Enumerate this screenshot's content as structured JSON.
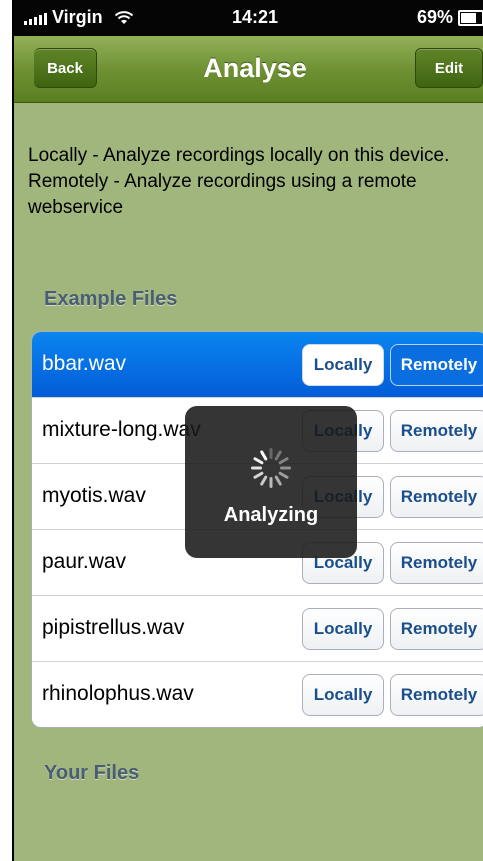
{
  "status_bar": {
    "carrier": "Virgin",
    "time": "14:21",
    "battery": "69%"
  },
  "nav": {
    "back_label": "Back",
    "title": "Analyse",
    "edit_label": "Edit"
  },
  "description": {
    "line1": "Locally - Analyze recordings locally on this device.",
    "line2": "Remotely - Analyze recordings using a remote webservice"
  },
  "sections": {
    "example_files": "Example Files",
    "your_files": "Your Files"
  },
  "files": [
    {
      "name": "bbar.wav",
      "local_label": "Locally",
      "remote_label": "Remotely",
      "selected": true
    },
    {
      "name": "mixture-long.wav",
      "local_label": "Locally",
      "remote_label": "Remotely",
      "selected": false
    },
    {
      "name": "myotis.wav",
      "local_label": "Locally",
      "remote_label": "Remotely",
      "selected": false
    },
    {
      "name": "paur.wav",
      "local_label": "Locally",
      "remote_label": "Remotely",
      "selected": false
    },
    {
      "name": "pipistrellus.wav",
      "local_label": "Locally",
      "remote_label": "Remotely",
      "selected": false
    },
    {
      "name": "rhinolophus.wav",
      "local_label": "Locally",
      "remote_label": "Remotely",
      "selected": false
    }
  ],
  "hud": {
    "label": "Analyzing"
  },
  "colors": {
    "background": "#a0b67c",
    "nav_bar": "#6c8f31",
    "selected_row": "#0a85ef",
    "section_header": "#4a5d74"
  }
}
